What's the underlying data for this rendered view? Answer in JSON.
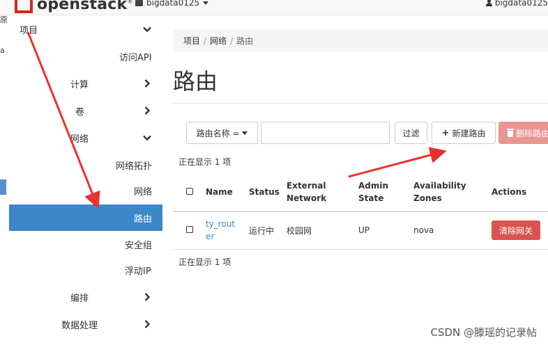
{
  "header": {
    "logo_text": "openstack",
    "project_name": "bigdata0125",
    "user_name": "bigdata0125"
  },
  "edge_fragments": [
    "原",
    "a"
  ],
  "sidebar": {
    "items": [
      {
        "label": "项目",
        "chevron": "down"
      },
      {
        "label": "访问API"
      },
      {
        "label": "计算",
        "chevron": "right"
      },
      {
        "label": "卷",
        "chevron": "right"
      },
      {
        "label": "网络",
        "chevron": "down"
      },
      {
        "label": "网络拓扑"
      },
      {
        "label": "网络"
      },
      {
        "label": "路由",
        "active": true
      },
      {
        "label": "安全组"
      },
      {
        "label": "浮动IP"
      },
      {
        "label": "编排",
        "chevron": "right"
      },
      {
        "label": "数据处理",
        "chevron": "right"
      }
    ]
  },
  "breadcrumb": [
    "项目",
    "网络",
    "路由"
  ],
  "page_title": "路由",
  "toolbar": {
    "filter_field": "路由名称 =",
    "filter_value": "",
    "filter_button": "过滤",
    "create_button": "新建路由",
    "delete_button": "删除路由"
  },
  "count_text_top": "正在显示 1 项",
  "count_text_bottom": "正在显示 1 项",
  "table": {
    "headers": [
      "Name",
      "Status",
      "External Network",
      "Admin State",
      "Availability Zones",
      "Actions"
    ],
    "rows": [
      {
        "name": "ty_router",
        "status": "运行中",
        "external_network": "校园网",
        "admin_state": "UP",
        "availability_zones": "nova",
        "action": "清除网关"
      }
    ]
  },
  "watermark": "CSDN @滕瑶的记录帖",
  "colors": {
    "brand_red": "#d9261c",
    "active_blue": "#3b87c8",
    "danger": "#d9534f",
    "annotation_arrow": "#e8322d"
  }
}
